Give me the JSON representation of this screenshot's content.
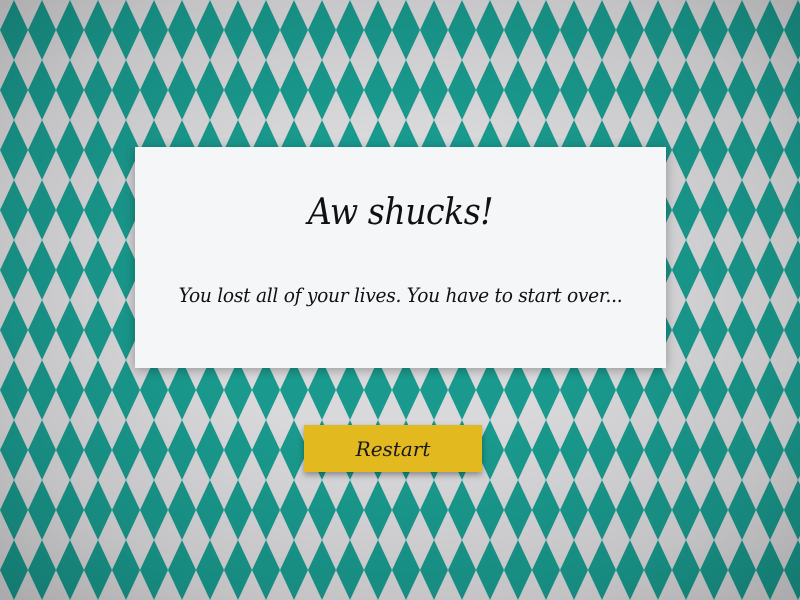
{
  "colors": {
    "pattern_teal": "#1a9a8e",
    "pattern_light": "#d9d9db",
    "dialog_background": "#f5f6f8",
    "button_yellow": "#e2b91e"
  },
  "dialog": {
    "title": "Aw shucks!",
    "message": "You lost all of your lives. You have to start over..."
  },
  "restart_button": {
    "label": "Restart"
  }
}
